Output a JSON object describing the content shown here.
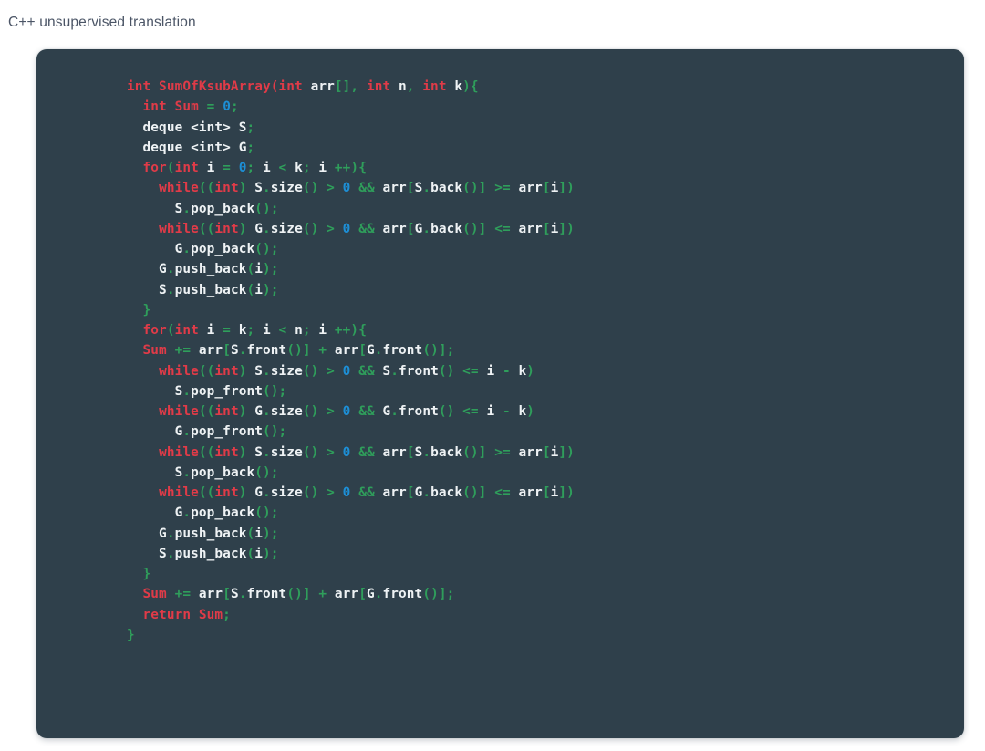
{
  "caption": "C++ unsupervised translation",
  "colors": {
    "page_background": "#ffffff",
    "caption_text": "#4b5566",
    "code_background": "#2f404b",
    "code_default_text": "#eef2f4",
    "token_keyword": "#e03b48",
    "token_operator": "#2f9e5b",
    "token_number": "#1d8fd6"
  },
  "code_block": {
    "language": "C++",
    "function_name": "SumOfKsubArray",
    "line_count": 31,
    "plain_text": "int SumOfKsubArray(int arr[], int n, int k){\n  int Sum = 0;\n  deque <int> S;\n  deque <int> G;\n  for(int i = 0; i < k; i ++){\n    while((int) S.size() > 0 && arr[S.back()] >= arr[i])\n      S.pop_back();\n    while((int) G.size() > 0 && arr[G.back()] <= arr[i])\n      G.pop_back();\n    G.push_back(i);\n    S.push_back(i);\n  }\n  for(int i = k; i < n; i ++){\n  Sum += arr[S.front()] + arr[G.front()];\n    while((int) S.size() > 0 && S.front() <= i - k)\n      S.pop_front();\n    while((int) G.size() > 0 && G.front() <= i - k)\n      G.pop_front();\n    while((int) S.size() > 0 && arr[S.back()] >= arr[i])\n      S.pop_back();\n    while((int) G.size() > 0 && arr[G.back()] <= arr[i])\n      G.pop_back();\n    G.push_back(i);\n    S.push_back(i);\n  }\n  Sum += arr[S.front()] + arr[G.front()];\n  return Sum;\n}",
    "lines": [
      [
        {
          "t": "int SumOfKsubArray(int ",
          "c": "kw"
        },
        {
          "t": "arr",
          "c": "id"
        },
        {
          "t": "[]",
          "c": "op"
        },
        {
          "t": ",",
          "c": "op"
        },
        {
          "t": " ",
          "c": "id"
        },
        {
          "t": "int",
          "c": "kw"
        },
        {
          "t": " n",
          "c": "id"
        },
        {
          "t": ",",
          "c": "op"
        },
        {
          "t": " ",
          "c": "id"
        },
        {
          "t": "int",
          "c": "kw"
        },
        {
          "t": " k",
          "c": "id"
        },
        {
          "t": "){",
          "c": "op"
        }
      ],
      [
        {
          "t": "  ",
          "c": "id"
        },
        {
          "t": "int Sum",
          "c": "kw"
        },
        {
          "t": " = ",
          "c": "op"
        },
        {
          "t": "0",
          "c": "num"
        },
        {
          "t": ";",
          "c": "op"
        }
      ],
      [
        {
          "t": "  deque ",
          "c": "id"
        },
        {
          "t": "<int>",
          "c": "id"
        },
        {
          "t": " S",
          "c": "id"
        },
        {
          "t": ";",
          "c": "op"
        }
      ],
      [
        {
          "t": "  deque ",
          "c": "id"
        },
        {
          "t": "<int>",
          "c": "id"
        },
        {
          "t": " G",
          "c": "id"
        },
        {
          "t": ";",
          "c": "op"
        }
      ],
      [
        {
          "t": "  ",
          "c": "id"
        },
        {
          "t": "for",
          "c": "kw"
        },
        {
          "t": "(",
          "c": "op"
        },
        {
          "t": "int",
          "c": "kw"
        },
        {
          "t": " i",
          "c": "id"
        },
        {
          "t": " = ",
          "c": "op"
        },
        {
          "t": "0",
          "c": "num"
        },
        {
          "t": "; ",
          "c": "op"
        },
        {
          "t": "i",
          "c": "id"
        },
        {
          "t": " < ",
          "c": "op"
        },
        {
          "t": "k",
          "c": "id"
        },
        {
          "t": "; ",
          "c": "op"
        },
        {
          "t": "i",
          "c": "id"
        },
        {
          "t": " ++){",
          "c": "op"
        }
      ],
      [
        {
          "t": "    ",
          "c": "id"
        },
        {
          "t": "while",
          "c": "kw"
        },
        {
          "t": "((",
          "c": "op"
        },
        {
          "t": "int",
          "c": "kw"
        },
        {
          "t": ")",
          "c": "op"
        },
        {
          "t": " S",
          "c": "id"
        },
        {
          "t": ".",
          "c": "op"
        },
        {
          "t": "size",
          "c": "id"
        },
        {
          "t": "()",
          "c": "op"
        },
        {
          "t": " > ",
          "c": "op"
        },
        {
          "t": "0",
          "c": "num"
        },
        {
          "t": " && ",
          "c": "op"
        },
        {
          "t": "arr",
          "c": "id"
        },
        {
          "t": "[",
          "c": "op"
        },
        {
          "t": "S",
          "c": "id"
        },
        {
          "t": ".",
          "c": "op"
        },
        {
          "t": "back",
          "c": "id"
        },
        {
          "t": "()]",
          "c": "op"
        },
        {
          "t": " >= ",
          "c": "op"
        },
        {
          "t": "arr",
          "c": "id"
        },
        {
          "t": "[",
          "c": "op"
        },
        {
          "t": "i",
          "c": "id"
        },
        {
          "t": "])",
          "c": "op"
        }
      ],
      [
        {
          "t": "      S",
          "c": "id"
        },
        {
          "t": ".",
          "c": "op"
        },
        {
          "t": "pop_back",
          "c": "id"
        },
        {
          "t": "();",
          "c": "op"
        }
      ],
      [
        {
          "t": "    ",
          "c": "id"
        },
        {
          "t": "while",
          "c": "kw"
        },
        {
          "t": "((",
          "c": "op"
        },
        {
          "t": "int",
          "c": "kw"
        },
        {
          "t": ")",
          "c": "op"
        },
        {
          "t": " G",
          "c": "id"
        },
        {
          "t": ".",
          "c": "op"
        },
        {
          "t": "size",
          "c": "id"
        },
        {
          "t": "()",
          "c": "op"
        },
        {
          "t": " > ",
          "c": "op"
        },
        {
          "t": "0",
          "c": "num"
        },
        {
          "t": " && ",
          "c": "op"
        },
        {
          "t": "arr",
          "c": "id"
        },
        {
          "t": "[",
          "c": "op"
        },
        {
          "t": "G",
          "c": "id"
        },
        {
          "t": ".",
          "c": "op"
        },
        {
          "t": "back",
          "c": "id"
        },
        {
          "t": "()]",
          "c": "op"
        },
        {
          "t": " <= ",
          "c": "op"
        },
        {
          "t": "arr",
          "c": "id"
        },
        {
          "t": "[",
          "c": "op"
        },
        {
          "t": "i",
          "c": "id"
        },
        {
          "t": "])",
          "c": "op"
        }
      ],
      [
        {
          "t": "      G",
          "c": "id"
        },
        {
          "t": ".",
          "c": "op"
        },
        {
          "t": "pop_back",
          "c": "id"
        },
        {
          "t": "();",
          "c": "op"
        }
      ],
      [
        {
          "t": "    G",
          "c": "id"
        },
        {
          "t": ".",
          "c": "op"
        },
        {
          "t": "push_back",
          "c": "id"
        },
        {
          "t": "(",
          "c": "op"
        },
        {
          "t": "i",
          "c": "id"
        },
        {
          "t": ");",
          "c": "op"
        }
      ],
      [
        {
          "t": "    S",
          "c": "id"
        },
        {
          "t": ".",
          "c": "op"
        },
        {
          "t": "push_back",
          "c": "id"
        },
        {
          "t": "(",
          "c": "op"
        },
        {
          "t": "i",
          "c": "id"
        },
        {
          "t": ");",
          "c": "op"
        }
      ],
      [
        {
          "t": "  }",
          "c": "op"
        }
      ],
      [
        {
          "t": "  ",
          "c": "id"
        },
        {
          "t": "for",
          "c": "kw"
        },
        {
          "t": "(",
          "c": "op"
        },
        {
          "t": "int",
          "c": "kw"
        },
        {
          "t": " i",
          "c": "id"
        },
        {
          "t": " = ",
          "c": "op"
        },
        {
          "t": "k",
          "c": "id"
        },
        {
          "t": "; ",
          "c": "op"
        },
        {
          "t": "i",
          "c": "id"
        },
        {
          "t": " < ",
          "c": "op"
        },
        {
          "t": "n",
          "c": "id"
        },
        {
          "t": "; ",
          "c": "op"
        },
        {
          "t": "i",
          "c": "id"
        },
        {
          "t": " ++){",
          "c": "op"
        }
      ],
      [
        {
          "t": "  ",
          "c": "id"
        },
        {
          "t": "Sum",
          "c": "kw"
        },
        {
          "t": " += ",
          "c": "op"
        },
        {
          "t": "arr",
          "c": "id"
        },
        {
          "t": "[",
          "c": "op"
        },
        {
          "t": "S",
          "c": "id"
        },
        {
          "t": ".",
          "c": "op"
        },
        {
          "t": "front",
          "c": "id"
        },
        {
          "t": "()]",
          "c": "op"
        },
        {
          "t": " + ",
          "c": "op"
        },
        {
          "t": "arr",
          "c": "id"
        },
        {
          "t": "[",
          "c": "op"
        },
        {
          "t": "G",
          "c": "id"
        },
        {
          "t": ".",
          "c": "op"
        },
        {
          "t": "front",
          "c": "id"
        },
        {
          "t": "()];",
          "c": "op"
        }
      ],
      [
        {
          "t": "    ",
          "c": "id"
        },
        {
          "t": "while",
          "c": "kw"
        },
        {
          "t": "((",
          "c": "op"
        },
        {
          "t": "int",
          "c": "kw"
        },
        {
          "t": ")",
          "c": "op"
        },
        {
          "t": " S",
          "c": "id"
        },
        {
          "t": ".",
          "c": "op"
        },
        {
          "t": "size",
          "c": "id"
        },
        {
          "t": "()",
          "c": "op"
        },
        {
          "t": " > ",
          "c": "op"
        },
        {
          "t": "0",
          "c": "num"
        },
        {
          "t": " && ",
          "c": "op"
        },
        {
          "t": "S",
          "c": "id"
        },
        {
          "t": ".",
          "c": "op"
        },
        {
          "t": "front",
          "c": "id"
        },
        {
          "t": "()",
          "c": "op"
        },
        {
          "t": " <= ",
          "c": "op"
        },
        {
          "t": "i",
          "c": "id"
        },
        {
          "t": " - ",
          "c": "op"
        },
        {
          "t": "k",
          "c": "id"
        },
        {
          "t": ")",
          "c": "op"
        }
      ],
      [
        {
          "t": "      S",
          "c": "id"
        },
        {
          "t": ".",
          "c": "op"
        },
        {
          "t": "pop_front",
          "c": "id"
        },
        {
          "t": "();",
          "c": "op"
        }
      ],
      [
        {
          "t": "    ",
          "c": "id"
        },
        {
          "t": "while",
          "c": "kw"
        },
        {
          "t": "((",
          "c": "op"
        },
        {
          "t": "int",
          "c": "kw"
        },
        {
          "t": ")",
          "c": "op"
        },
        {
          "t": " G",
          "c": "id"
        },
        {
          "t": ".",
          "c": "op"
        },
        {
          "t": "size",
          "c": "id"
        },
        {
          "t": "()",
          "c": "op"
        },
        {
          "t": " > ",
          "c": "op"
        },
        {
          "t": "0",
          "c": "num"
        },
        {
          "t": " && ",
          "c": "op"
        },
        {
          "t": "G",
          "c": "id"
        },
        {
          "t": ".",
          "c": "op"
        },
        {
          "t": "front",
          "c": "id"
        },
        {
          "t": "()",
          "c": "op"
        },
        {
          "t": " <= ",
          "c": "op"
        },
        {
          "t": "i",
          "c": "id"
        },
        {
          "t": " - ",
          "c": "op"
        },
        {
          "t": "k",
          "c": "id"
        },
        {
          "t": ")",
          "c": "op"
        }
      ],
      [
        {
          "t": "      G",
          "c": "id"
        },
        {
          "t": ".",
          "c": "op"
        },
        {
          "t": "pop_front",
          "c": "id"
        },
        {
          "t": "();",
          "c": "op"
        }
      ],
      [
        {
          "t": "    ",
          "c": "id"
        },
        {
          "t": "while",
          "c": "kw"
        },
        {
          "t": "((",
          "c": "op"
        },
        {
          "t": "int",
          "c": "kw"
        },
        {
          "t": ")",
          "c": "op"
        },
        {
          "t": " S",
          "c": "id"
        },
        {
          "t": ".",
          "c": "op"
        },
        {
          "t": "size",
          "c": "id"
        },
        {
          "t": "()",
          "c": "op"
        },
        {
          "t": " > ",
          "c": "op"
        },
        {
          "t": "0",
          "c": "num"
        },
        {
          "t": " && ",
          "c": "op"
        },
        {
          "t": "arr",
          "c": "id"
        },
        {
          "t": "[",
          "c": "op"
        },
        {
          "t": "S",
          "c": "id"
        },
        {
          "t": ".",
          "c": "op"
        },
        {
          "t": "back",
          "c": "id"
        },
        {
          "t": "()]",
          "c": "op"
        },
        {
          "t": " >= ",
          "c": "op"
        },
        {
          "t": "arr",
          "c": "id"
        },
        {
          "t": "[",
          "c": "op"
        },
        {
          "t": "i",
          "c": "id"
        },
        {
          "t": "])",
          "c": "op"
        }
      ],
      [
        {
          "t": "      S",
          "c": "id"
        },
        {
          "t": ".",
          "c": "op"
        },
        {
          "t": "pop_back",
          "c": "id"
        },
        {
          "t": "();",
          "c": "op"
        }
      ],
      [
        {
          "t": "    ",
          "c": "id"
        },
        {
          "t": "while",
          "c": "kw"
        },
        {
          "t": "((",
          "c": "op"
        },
        {
          "t": "int",
          "c": "kw"
        },
        {
          "t": ")",
          "c": "op"
        },
        {
          "t": " G",
          "c": "id"
        },
        {
          "t": ".",
          "c": "op"
        },
        {
          "t": "size",
          "c": "id"
        },
        {
          "t": "()",
          "c": "op"
        },
        {
          "t": " > ",
          "c": "op"
        },
        {
          "t": "0",
          "c": "num"
        },
        {
          "t": " && ",
          "c": "op"
        },
        {
          "t": "arr",
          "c": "id"
        },
        {
          "t": "[",
          "c": "op"
        },
        {
          "t": "G",
          "c": "id"
        },
        {
          "t": ".",
          "c": "op"
        },
        {
          "t": "back",
          "c": "id"
        },
        {
          "t": "()]",
          "c": "op"
        },
        {
          "t": " <= ",
          "c": "op"
        },
        {
          "t": "arr",
          "c": "id"
        },
        {
          "t": "[",
          "c": "op"
        },
        {
          "t": "i",
          "c": "id"
        },
        {
          "t": "])",
          "c": "op"
        }
      ],
      [
        {
          "t": "      G",
          "c": "id"
        },
        {
          "t": ".",
          "c": "op"
        },
        {
          "t": "pop_back",
          "c": "id"
        },
        {
          "t": "();",
          "c": "op"
        }
      ],
      [
        {
          "t": "    G",
          "c": "id"
        },
        {
          "t": ".",
          "c": "op"
        },
        {
          "t": "push_back",
          "c": "id"
        },
        {
          "t": "(",
          "c": "op"
        },
        {
          "t": "i",
          "c": "id"
        },
        {
          "t": ");",
          "c": "op"
        }
      ],
      [
        {
          "t": "    S",
          "c": "id"
        },
        {
          "t": ".",
          "c": "op"
        },
        {
          "t": "push_back",
          "c": "id"
        },
        {
          "t": "(",
          "c": "op"
        },
        {
          "t": "i",
          "c": "id"
        },
        {
          "t": ");",
          "c": "op"
        }
      ],
      [
        {
          "t": "  }",
          "c": "op"
        }
      ],
      [
        {
          "t": "  ",
          "c": "id"
        },
        {
          "t": "Sum",
          "c": "kw"
        },
        {
          "t": " += ",
          "c": "op"
        },
        {
          "t": "arr",
          "c": "id"
        },
        {
          "t": "[",
          "c": "op"
        },
        {
          "t": "S",
          "c": "id"
        },
        {
          "t": ".",
          "c": "op"
        },
        {
          "t": "front",
          "c": "id"
        },
        {
          "t": "()]",
          "c": "op"
        },
        {
          "t": " + ",
          "c": "op"
        },
        {
          "t": "arr",
          "c": "id"
        },
        {
          "t": "[",
          "c": "op"
        },
        {
          "t": "G",
          "c": "id"
        },
        {
          "t": ".",
          "c": "op"
        },
        {
          "t": "front",
          "c": "id"
        },
        {
          "t": "()];",
          "c": "op"
        }
      ],
      [
        {
          "t": "  return Sum",
          "c": "kw"
        },
        {
          "t": ";",
          "c": "op"
        }
      ],
      [
        {
          "t": "}",
          "c": "op"
        }
      ]
    ]
  }
}
